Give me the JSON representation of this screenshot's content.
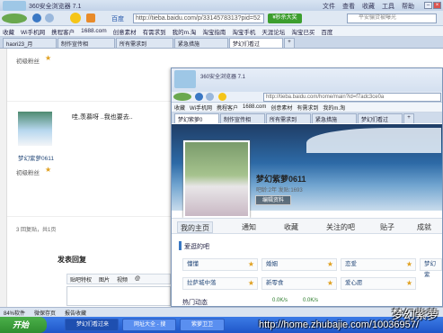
{
  "browser": {
    "title": "360安全浏览器 7.1",
    "menu": [
      "文件",
      "查看",
      "收藏",
      "工具",
      "帮助"
    ],
    "urlbar_prefix": "百度",
    "url": "http://tieba.baidu.com/p/3314578313?pid=52",
    "hot_button": "¥秒杀大奖",
    "search_placeholder": "平安骗贷被曝光"
  },
  "favorites": [
    "收藏",
    "Wi手机网",
    "携程客户",
    "1688.com",
    "创意素材",
    "有需求到",
    "我的m.淘",
    "淘宝指南",
    "淘宝手机",
    "天涯论坛",
    "淘宝已买",
    "百度"
  ],
  "tabs": [
    "haori23_月",
    "制作宣传相",
    "所有需求到",
    "紧急措施",
    "梦幻们看过"
  ],
  "old_page": {
    "fans_label": "初级粉丝",
    "fans_label2": "初级粉丝",
    "username": "梦幻紫萝0611",
    "reply_text": "哇,羡慕呀 ..我也要去..",
    "reply_count": "3 回复贴，共1页",
    "post_reply": "发表回复",
    "toolbar": [
      "贴吧特权",
      "图片",
      "视频",
      "@"
    ]
  },
  "window2": {
    "title": "360安全浏览器 7.1",
    "url": "http://tieba.baidu.com/home/main?id=f7adc3ce0a",
    "favorites": [
      "收藏",
      "Wi手机网",
      "携程客户",
      "1688.com",
      "创意素材",
      "有需求到",
      "我的m.淘"
    ],
    "tabs": [
      "梦幻紫萝0",
      "制作宣传相",
      "所有需求到",
      "紧急措施",
      "梦幻们看过"
    ],
    "edit_button": "编辑资料",
    "profile_name": "梦幻紫萝0611",
    "profile_meta": "吧龄:2年 发贴:1693",
    "nav": [
      "我的主页",
      "通知",
      "收藏",
      "关注的吧",
      "贴子",
      "成就"
    ],
    "section_title": "爱逛的吧",
    "bars": [
      "懂懂",
      "婚姻",
      "恋爱",
      "梦幻紫",
      "拉萨城中落",
      "新零食",
      "爱心愿"
    ],
    "section2": "热门动态",
    "speed": [
      "0.0K/s",
      "0.0K/s"
    ]
  },
  "statusbar": {
    "items": [
      "84%软件",
      "微保存页",
      "报告收藏"
    ]
  },
  "taskbar": {
    "start": "开始",
    "tasks": [
      "梦幻们看过来",
      "网址大全 - 搜",
      "紫萝卫卫"
    ]
  },
  "watermark": {
    "line1": "梦幻紫萝",
    "line2": "http://home.zhubajie.com/10036957/"
  }
}
